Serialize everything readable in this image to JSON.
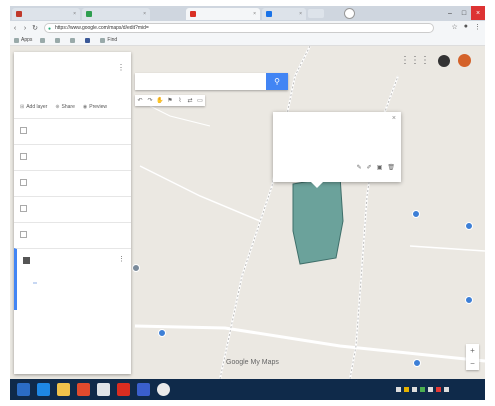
{
  "browser": {
    "tabs": [
      {
        "label": "",
        "favicon_color": "#c0392b"
      },
      {
        "label": "",
        "favicon_color": "#2e9e4f"
      },
      {
        "label": "",
        "favicon_color": "#d93025",
        "active": true
      },
      {
        "label": "",
        "favicon_color": "#1a73e8"
      }
    ],
    "url": "https://www.google.com/maps/d/edit?mid=",
    "bookmarks": [
      "Apps",
      "",
      "",
      "",
      "",
      "Find"
    ]
  },
  "map": {
    "search_placeholder": "",
    "panel": {
      "title": "",
      "subtitle": "",
      "description": "",
      "actions": [
        "Add layer",
        "Share",
        "Preview"
      ],
      "layers": [
        "",
        "",
        "",
        "",
        "",
        ""
      ],
      "selected_layer": "",
      "selected_sub_items": [
        "",
        ""
      ],
      "basemap_label": ""
    },
    "info_window": {
      "title": "",
      "line1": "",
      "line2": "",
      "style_label": ""
    },
    "places": [
      {
        "label": "",
        "blue": false
      },
      {
        "label": "",
        "blue": false
      },
      {
        "label": "",
        "blue": false
      },
      {
        "label": "",
        "blue": false
      },
      {
        "label": "",
        "blue": true
      },
      {
        "label": "",
        "blue": true
      },
      {
        "label": "",
        "blue": false
      },
      {
        "label": "",
        "blue": false
      },
      {
        "label": "",
        "blue": true
      },
      {
        "label": "",
        "blue": false
      }
    ],
    "logo": "Google My Maps",
    "copyright": "",
    "polygon_color": "#5d9a94"
  },
  "taskbar": {
    "time": "",
    "date": ""
  }
}
